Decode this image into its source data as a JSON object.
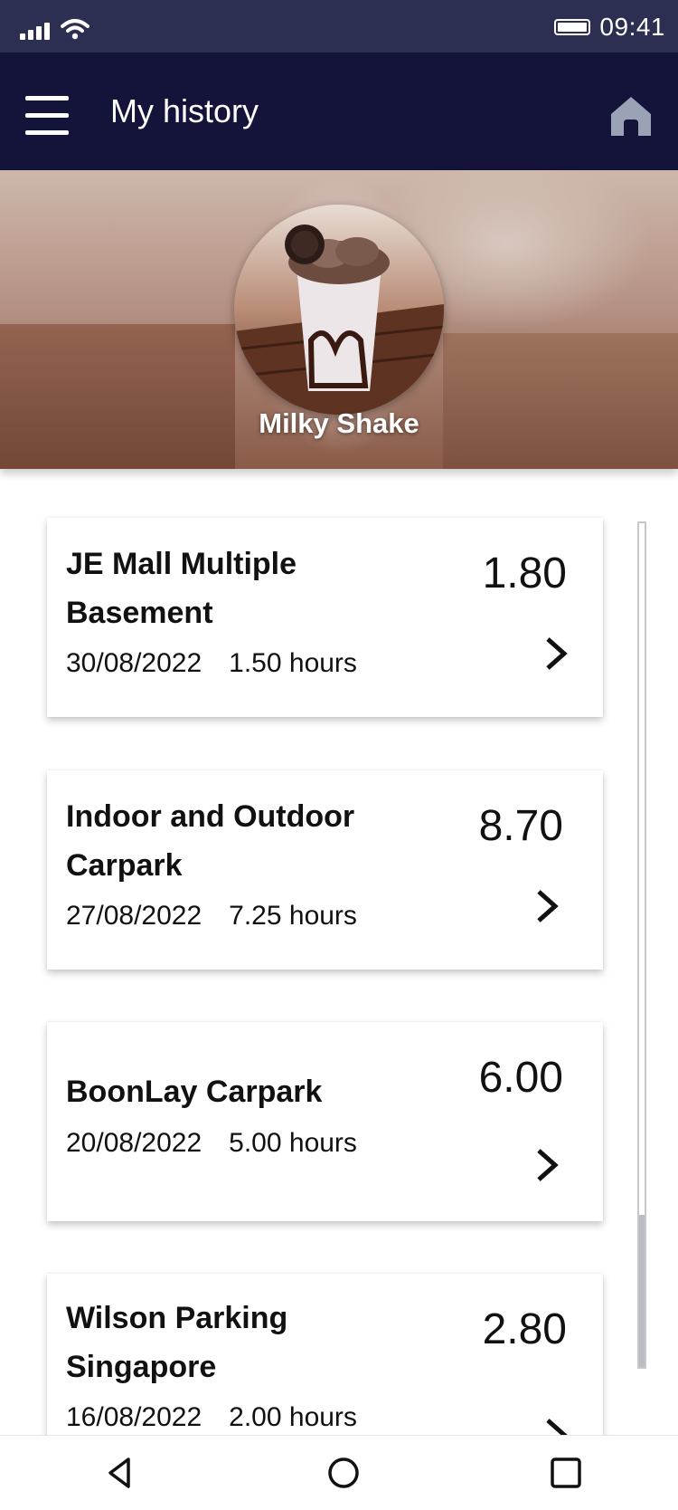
{
  "status_bar": {
    "time": "09:41",
    "icons": [
      "signal-icon",
      "wifi-icon",
      "battery-icon"
    ]
  },
  "app_bar": {
    "title": "My history",
    "menu_icon": "menu-icon",
    "home_icon": "home-icon"
  },
  "profile": {
    "name": "Milky Shake",
    "avatar": "milkshake-photo"
  },
  "history": [
    {
      "name": "JE Mall Multiple Basement",
      "date": "30/08/2022",
      "hours": "1.50 hours",
      "amount": "1.80"
    },
    {
      "name": "Indoor and Outdoor Carpark",
      "date": "27/08/2022",
      "hours": "7.25 hours",
      "amount": "8.70"
    },
    {
      "name": "BoonLay Carpark",
      "date": "20/08/2022",
      "hours": "5.00 hours",
      "amount": "6.00"
    },
    {
      "name": "Wilson Parking Singapore",
      "date": "16/08/2022",
      "hours": "2.00 hours",
      "amount": "2.80"
    }
  ],
  "nav_bar": {
    "icons": [
      "back-icon",
      "home-circle-icon",
      "recents-icon"
    ]
  },
  "colors": {
    "status_bar": "#2c2f52",
    "app_bar": "#14143a",
    "home_icon": "#9aa3b5"
  }
}
